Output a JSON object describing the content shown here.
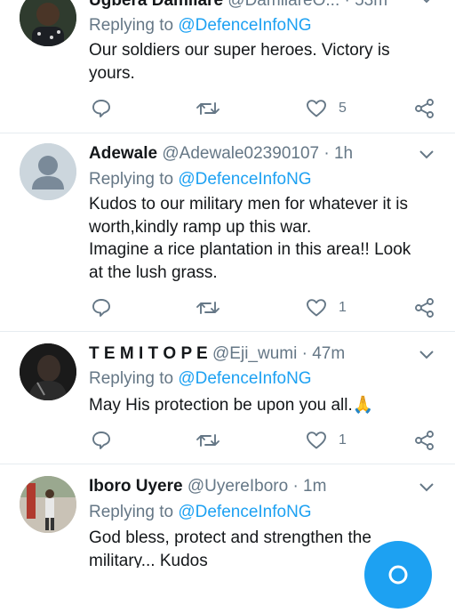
{
  "tweets": [
    {
      "name": "Ugbera Damilare",
      "handle": "@DamilareO...",
      "time": "53m",
      "reply_prefix": "Replying to",
      "reply_to": "@DefenceInfoNG",
      "body": [
        "Our soldiers our super heroes. Victory is",
        "yours."
      ],
      "like_count": "5"
    },
    {
      "name": "Adewale",
      "handle": "@Adewale02390107",
      "time": "1h",
      "reply_prefix": "Replying to",
      "reply_to": "@DefenceInfoNG",
      "body": [
        "Kudos to our military men for whatever it is",
        "worth,kindly ramp up this war.",
        "Imagine a rice plantation in this area!! Look",
        "at the lush grass."
      ],
      "like_count": "1"
    },
    {
      "name": "T E M I T O P E",
      "handle": "@Eji_wumi",
      "time": "47m",
      "reply_prefix": "Replying to",
      "reply_to": "@DefenceInfoNG",
      "body": [
        "May His protection be upon you all.🙏"
      ],
      "like_count": "1"
    },
    {
      "name": "Iboro Uyere",
      "handle": "@UyereIboro",
      "time": "1m",
      "reply_prefix": "Replying to",
      "reply_to": "@DefenceInfoNG",
      "body": [
        "God bless, protect and strengthen the",
        "military... Kudos"
      ],
      "like_count": ""
    }
  ],
  "separator": "·",
  "colors": {
    "accent": "#1da1f2",
    "secondary": "#657786",
    "divider": "#e6ecf0"
  }
}
